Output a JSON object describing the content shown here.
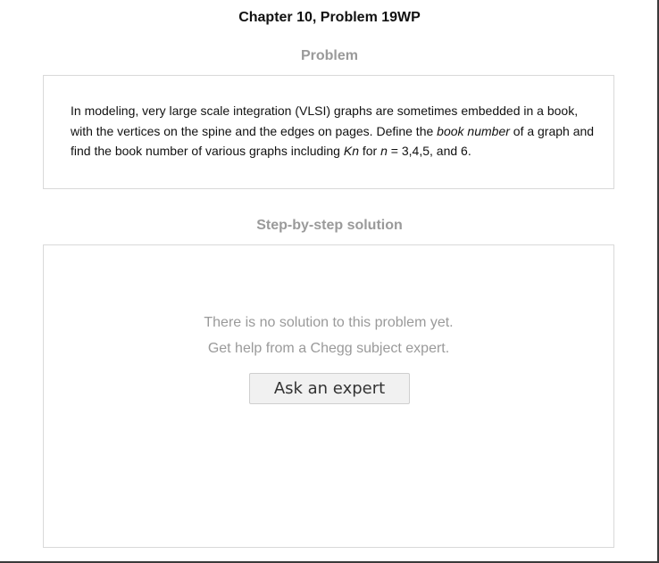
{
  "page": {
    "title": "Chapter 10, Problem 19WP"
  },
  "problem": {
    "heading": "Problem",
    "text_parts": [
      "In modeling, very large scale integration (VLSI) graphs are sometimes embedded in a book, with the vertices on the spine and the edges on pages. Define the ",
      "book number",
      " of a graph and find the book number of various graphs including ",
      "Kn",
      " for ",
      "n",
      " = 3,4,5, and 6."
    ]
  },
  "solution": {
    "heading": "Step-by-step solution",
    "empty_line1": "There is no solution to this problem yet.",
    "empty_line2": "Get help from a Chegg subject expert.",
    "ask_button_label": "Ask an expert"
  },
  "colors": {
    "heading_gray": "#9a9a9a",
    "panel_border": "#d9d9d9",
    "button_bg": "#f1f1f1"
  }
}
